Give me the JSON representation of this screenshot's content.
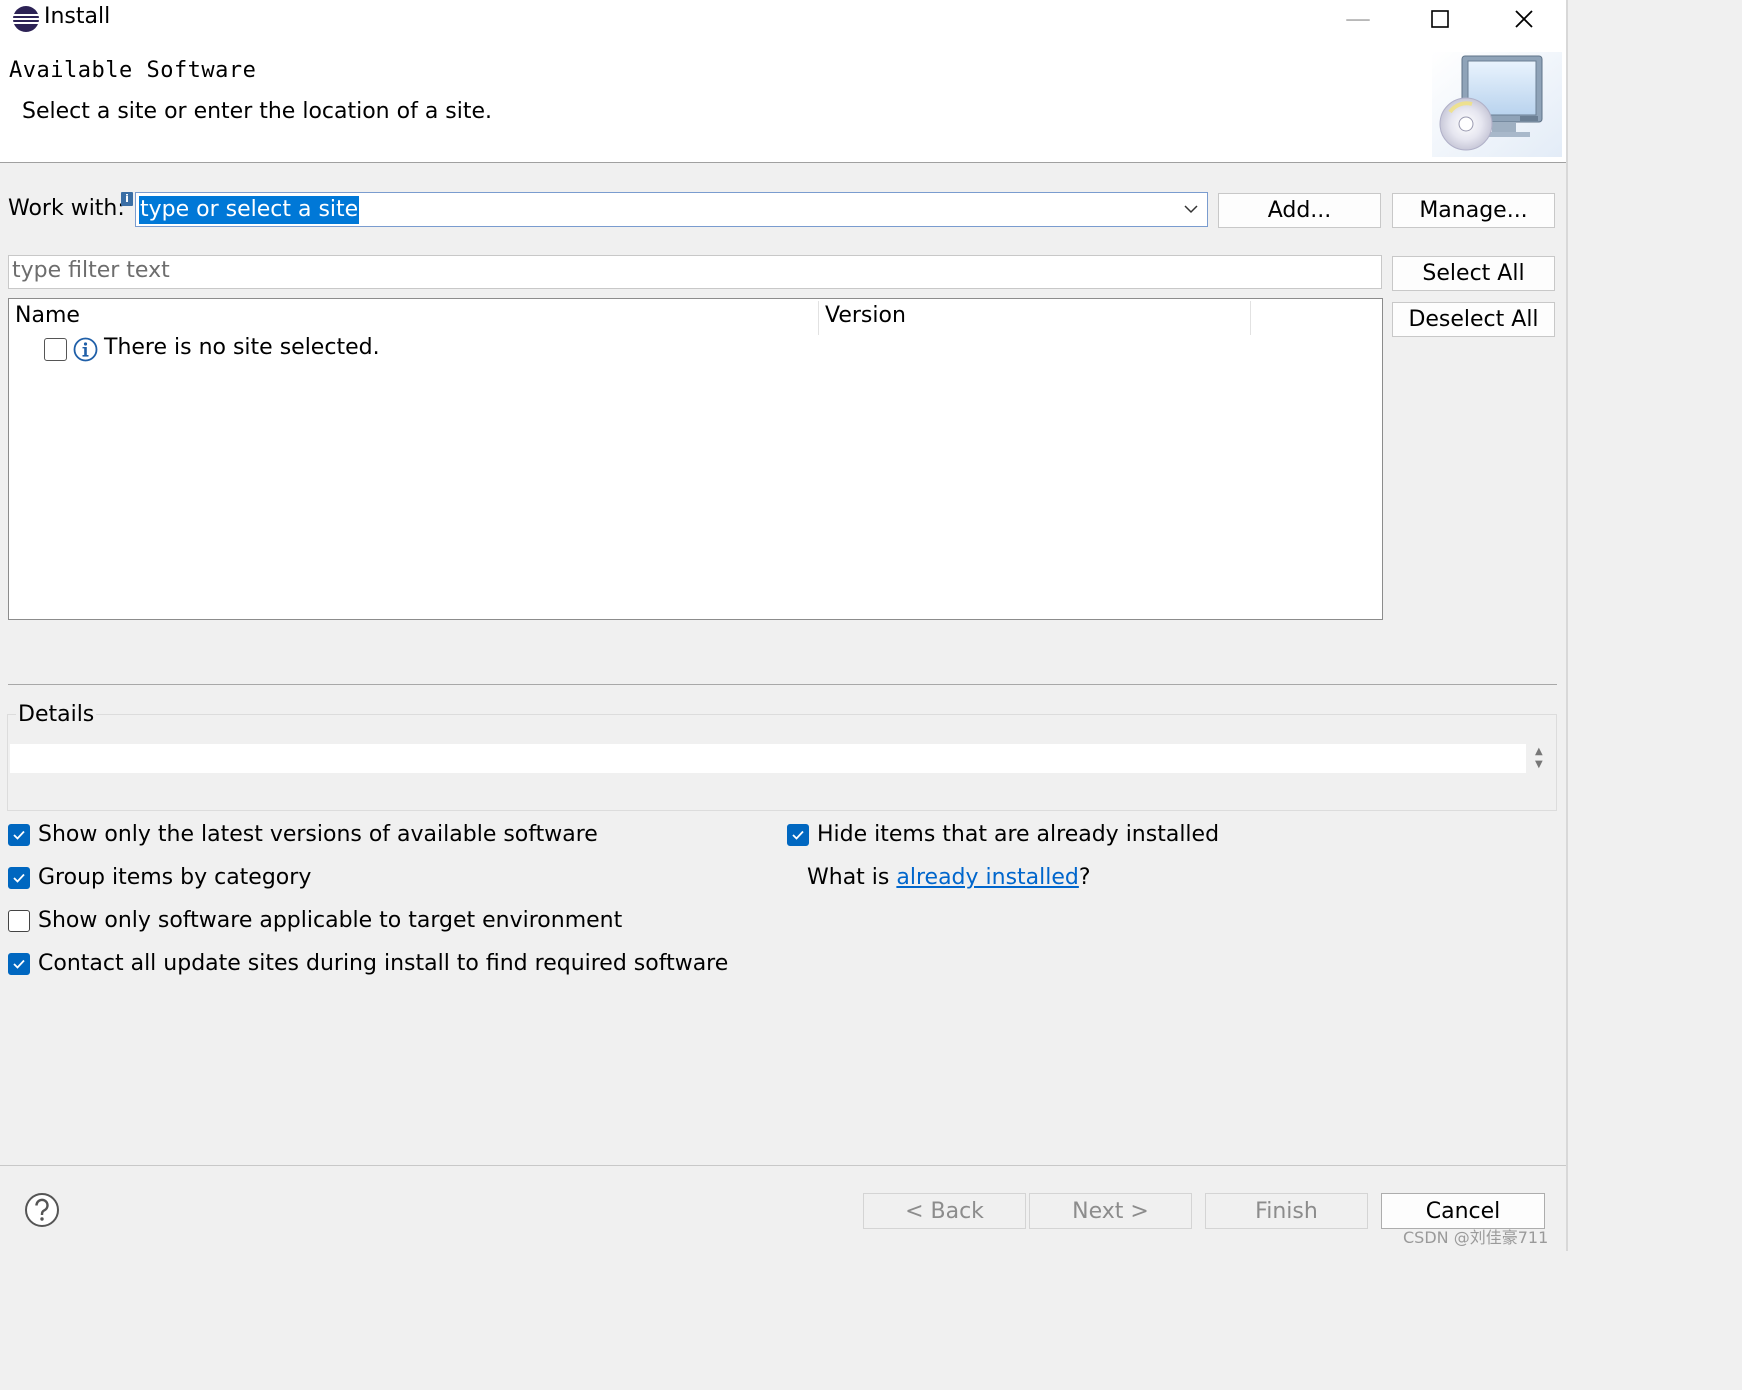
{
  "window": {
    "title": "Install"
  },
  "header": {
    "title": "Available Software",
    "description": "Select a site or enter the location of a site."
  },
  "work_with": {
    "label": "Work with:",
    "value": "type or select a site",
    "add_label": "Add...",
    "manage_label": "Manage..."
  },
  "filter": {
    "placeholder": "type filter text",
    "select_all_label": "Select All",
    "deselect_all_label": "Deselect All"
  },
  "table": {
    "columns": [
      "Name",
      "Version"
    ],
    "rows": [
      {
        "text": "There is no site selected.",
        "checked": false
      }
    ]
  },
  "details": {
    "label": "Details"
  },
  "options": {
    "show_latest": {
      "label": "Show only the latest versions of available software",
      "checked": true
    },
    "group_by_category": {
      "label": "Group items by category",
      "checked": true
    },
    "applicable_only": {
      "label": "Show only software applicable to target environment",
      "checked": false
    },
    "contact_all": {
      "label": "Contact all update sites during install to find required software",
      "checked": true
    },
    "hide_installed": {
      "label": "Hide items that are already installed",
      "checked": true
    },
    "what_is_prefix": "What is ",
    "what_is_link": "already installed",
    "what_is_suffix": "?"
  },
  "footer": {
    "back_label": "< Back",
    "next_label": "Next >",
    "finish_label": "Finish",
    "cancel_label": "Cancel"
  },
  "watermark": "CSDN @刘佳豪711",
  "colors": {
    "accent": "#0067c0",
    "selection": "#0078d7",
    "link": "#0066cc"
  }
}
